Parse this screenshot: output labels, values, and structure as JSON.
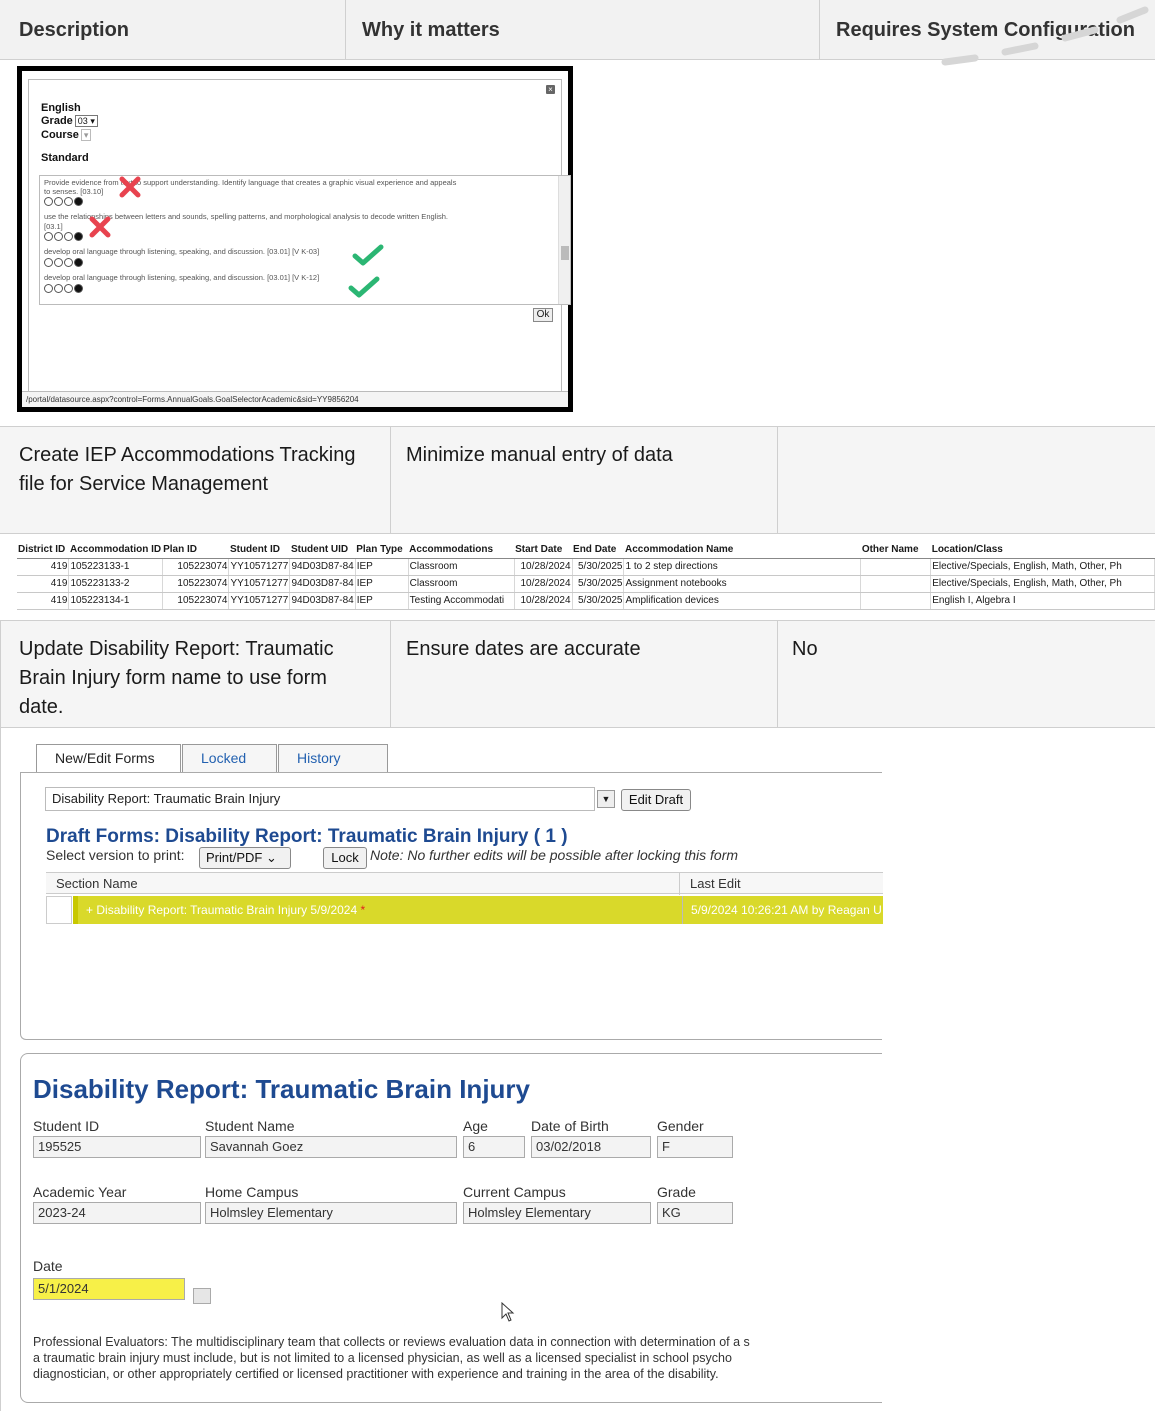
{
  "header": {
    "description": "Description",
    "why": "Why it matters",
    "config": "Requires System Configuration"
  },
  "standard_popup": {
    "subject": "English",
    "grade_label": "Grade",
    "grade_value": "03",
    "course_label": "Course",
    "standard_label": "Standard",
    "items": [
      "Provide evidence from text to support understanding. Identify language that creates a graphic visual experience and appeals",
      "to senses. [03.10]",
      "use the relationships between letters and sounds, spelling patterns, and morphological analysis to decode written English.",
      "[03.1]",
      "develop oral language through listening, speaking, and discussion. [03.01] [V K-03]",
      "develop oral language through listening, speaking, and discussion. [03.01] [V K-12]"
    ],
    "ok_label": "Ok",
    "url": "/portal/datasource.aspx?control=Forms.AnnualGoals.GoalSelectorAcademic&sid=YY9856204"
  },
  "row1": {
    "description": "Create IEP Accommodations Tracking file for Service Management",
    "why": "Minimize manual entry of data",
    "config": ""
  },
  "accommodations": {
    "headers": [
      "District ID",
      "Accommodation ID",
      "Plan ID",
      "Student ID",
      "Student UID",
      "Plan Type",
      "Accommodations",
      "Start Date",
      "End Date",
      "Accommodation Name",
      "Other Name",
      "Location/Class"
    ],
    "rows": [
      [
        "419",
        "105223133-1",
        "105223074",
        "YY10571277",
        "94D03D87-84",
        "IEP",
        "Classroom",
        "10/28/2024",
        "5/30/2025",
        "1 to 2 step directions",
        "",
        "Elective/Specials, English, Math, Other, Ph"
      ],
      [
        "419",
        "105223133-2",
        "105223074",
        "YY10571277",
        "94D03D87-84",
        "IEP",
        "Classroom",
        "10/28/2024",
        "5/30/2025",
        "Assignment notebooks",
        "",
        "Elective/Specials, English, Math, Other, Ph"
      ],
      [
        "419",
        "105223134-1",
        "105223074",
        "YY10571277",
        "94D03D87-84",
        "IEP",
        "Testing Accommodati",
        "10/28/2024",
        "5/30/2025",
        "Amplification devices",
        "",
        "English I, Algebra I"
      ]
    ]
  },
  "row2": {
    "description": "Update Disability Report: Traumatic Brain Injury form name to use form date.",
    "why": "Ensure dates are accurate",
    "config": "No"
  },
  "forms": {
    "tabs": [
      "New/Edit Forms",
      "Locked",
      "History"
    ],
    "dropdown_value": "Disability Report: Traumatic Brain Injury",
    "edit_draft_label": "Edit Draft",
    "draft_title": "Draft Forms: Disability Report: Traumatic Brain Injury ( 1 )",
    "select_version_label": "Select version to print:",
    "print_option": "Print/PDF",
    "lock_label": "Lock",
    "note": "Note: No further edits will be possible after locking this form",
    "section_name_header": "Section Name",
    "last_edit_header": "Last Edit",
    "section_row_name": "Disability Report: Traumatic Brain Injury 5/9/2024",
    "section_row_edit": "5/9/2024 10:26:21 AM by Reagan U"
  },
  "tbi_form": {
    "title": "Disability Report: Traumatic Brain Injury",
    "student_id_label": "Student ID",
    "student_id": "195525",
    "student_name_label": "Student Name",
    "student_name": "Savannah Goez",
    "age_label": "Age",
    "age": "6",
    "dob_label": "Date of Birth",
    "dob": "03/02/2018",
    "gender_label": "Gender",
    "gender": "F",
    "year_label": "Academic Year",
    "year": "2023-24",
    "home_label": "Home Campus",
    "home": "Holmsley Elementary",
    "current_label": "Current Campus",
    "current": "Holmsley Elementary",
    "grade_label": "Grade",
    "grade": "KG",
    "date_label": "Date",
    "date": "5/1/2024",
    "para1": "Professional Evaluators: The multidisciplinary team that collects or reviews evaluation data in connection with determination of a s",
    "para2": "a traumatic brain injury must include, but is not limited to a licensed physician, as well as a licensed specialist in school psycho",
    "para3": "diagnostician, or other appropriately certified or licensed practitioner with experience and training in the area of the disability."
  },
  "colors": {
    "header_bg": "#f2f2f2",
    "title_blue": "#1e4a91",
    "link_blue": "#2361b0",
    "highlight": "#d9d92a",
    "field_highlight": "#f7f048",
    "check_green": "#2bb673",
    "cross_red": "#e8434f"
  }
}
